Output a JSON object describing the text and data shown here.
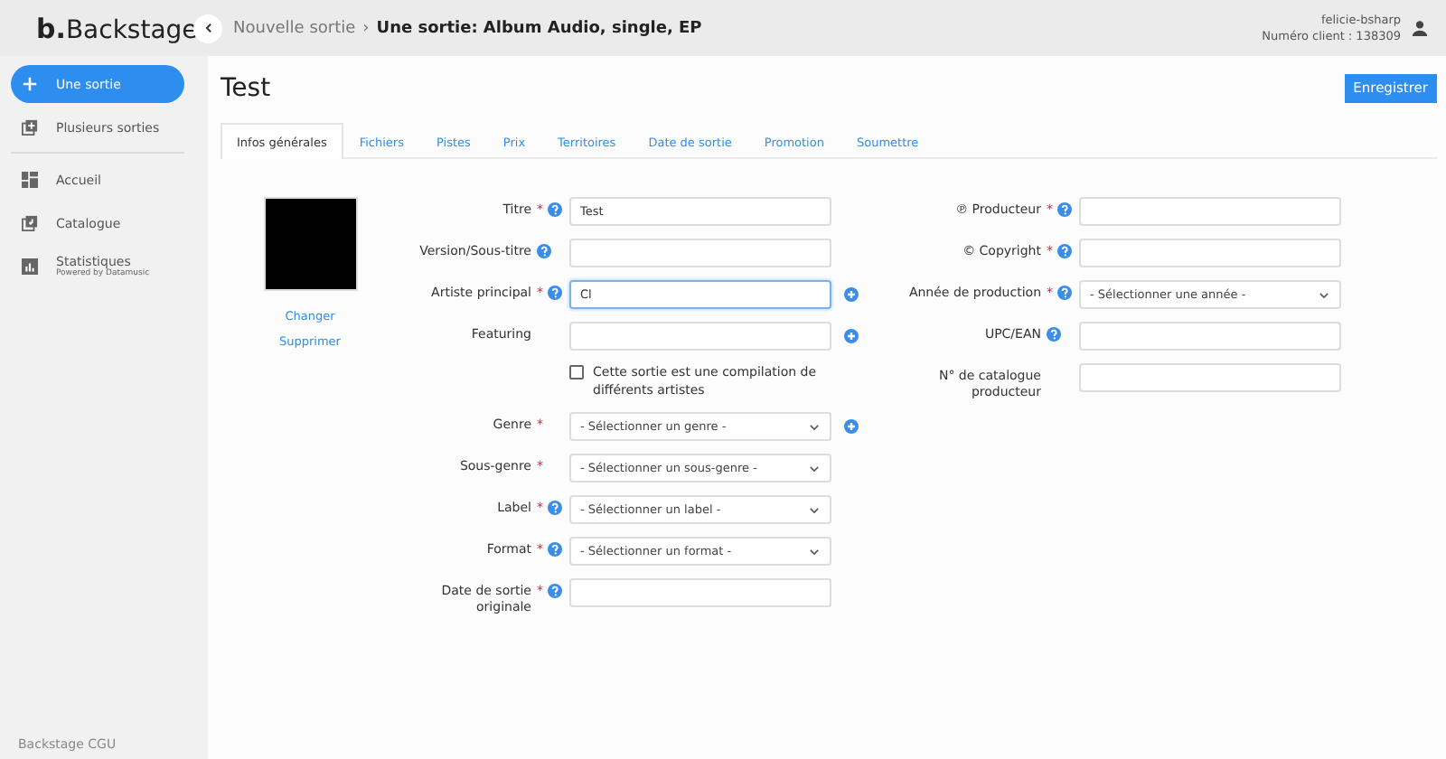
{
  "header": {
    "logo_mark": "b.",
    "logo_name": "Backstage",
    "breadcrumb": [
      {
        "label": "Nouvelle sortie",
        "current": false
      },
      {
        "label": "Une sortie: Album Audio, single, EP",
        "current": true
      }
    ],
    "separator": "›",
    "user": {
      "name": "felicie-bsharp",
      "client": "Numéro client : 138309"
    }
  },
  "sidebar": {
    "items": [
      {
        "label": "Une sortie",
        "selected": true
      },
      {
        "label": "Plusieurs sorties",
        "selected": false
      },
      {
        "label": "Accueil",
        "selected": false
      },
      {
        "label": "Catalogue",
        "selected": false
      },
      {
        "label": "Statistiques",
        "sublabel": "Powered by Datamusic",
        "selected": false
      }
    ],
    "footer": "Backstage CGU"
  },
  "page": {
    "title": "Test",
    "required_mark": "*",
    "save_button": "Enregistrer",
    "tabs": [
      {
        "label": "Infos générales",
        "selected": true
      },
      {
        "label": "Fichiers",
        "selected": false
      },
      {
        "label": "Pistes",
        "selected": false
      },
      {
        "label": "Prix",
        "selected": false
      },
      {
        "label": "Territoires",
        "selected": false
      },
      {
        "label": "Date de sortie",
        "selected": false
      },
      {
        "label": "Promotion",
        "selected": false
      },
      {
        "label": "Soumettre",
        "selected": false
      }
    ],
    "cover": {
      "change": "Changer",
      "delete": "Supprimer"
    },
    "left_fields": [
      {
        "kind": "text",
        "label": "Titre",
        "required": true,
        "help": true,
        "value": "Test",
        "focused": false,
        "add": false
      },
      {
        "kind": "text",
        "label": "Version/Sous-titre",
        "required": false,
        "help": true,
        "focused": false,
        "add": false
      },
      {
        "kind": "text",
        "label": "Artiste principal",
        "required": true,
        "help": true,
        "value": "Cl",
        "focused": true,
        "add": true
      },
      {
        "kind": "text",
        "label": "Featuring",
        "required": false,
        "help": false,
        "focused": false,
        "add": true
      },
      {
        "kind": "checkbox",
        "label": "Cette sortie est une compilation de différents artistes",
        "checked": false
      },
      {
        "kind": "select",
        "label": "Genre",
        "required": true,
        "help": false,
        "value": "- Sélectionner un genre -",
        "focused": false,
        "add": true
      },
      {
        "kind": "select",
        "label": "Sous-genre",
        "required": true,
        "help": false,
        "value": "- Sélectionner un sous-genre -",
        "focused": false,
        "add": false
      },
      {
        "kind": "select",
        "label": "Label",
        "required": true,
        "help": true,
        "value": "- Sélectionner un label -",
        "focused": false,
        "add": false
      },
      {
        "kind": "select",
        "label": "Format",
        "required": true,
        "help": true,
        "value": "- Sélectionner un format -",
        "focused": false,
        "add": false
      },
      {
        "kind": "text",
        "label": "Date de sortie originale",
        "required": true,
        "help": true,
        "focused": false,
        "add": false
      }
    ],
    "right_fields": [
      {
        "kind": "text",
        "label": "℗ Producteur",
        "required": true,
        "help": true,
        "focused": false,
        "add": false
      },
      {
        "kind": "text",
        "label": "© Copyright",
        "required": true,
        "help": true,
        "focused": false,
        "add": false
      },
      {
        "kind": "select",
        "label": "Année de production",
        "required": true,
        "help": true,
        "value": "- Sélectionner une année -",
        "focused": false,
        "add": false
      },
      {
        "kind": "text",
        "label": "UPC/EAN",
        "required": false,
        "help": true,
        "focused": false,
        "add": false
      },
      {
        "kind": "text",
        "label": "N° de catalogue producteur",
        "required": false,
        "help": false,
        "focused": false,
        "add": false
      }
    ]
  }
}
